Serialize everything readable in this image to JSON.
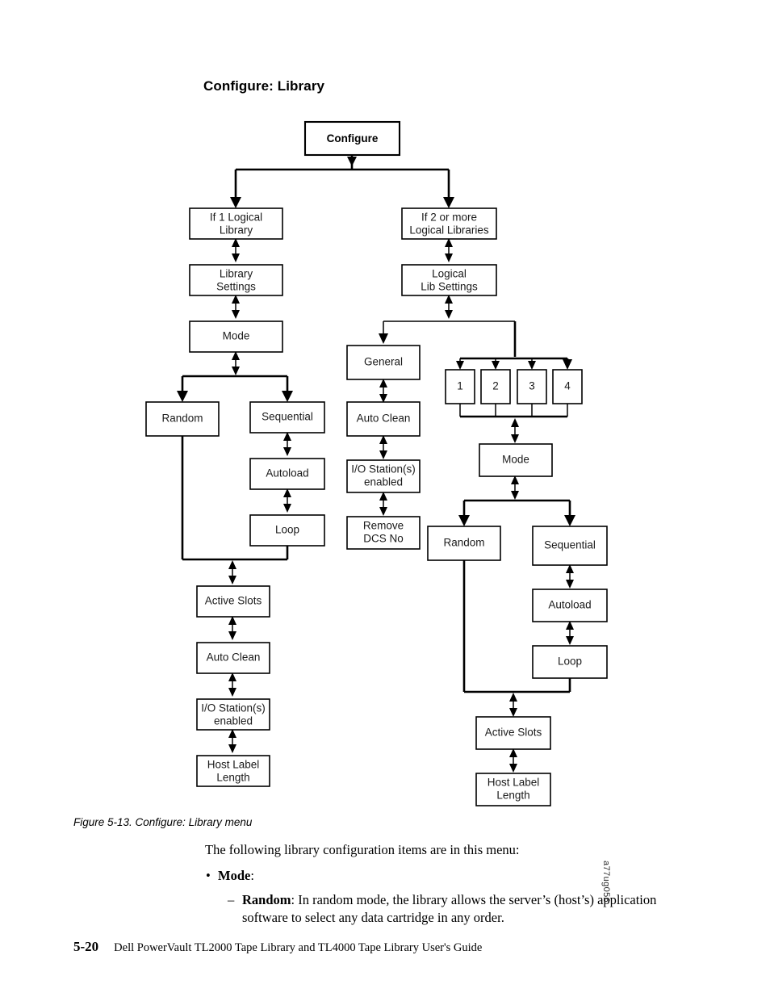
{
  "section": {
    "title": "Configure: Library"
  },
  "figure": {
    "caption": "Figure 5-13. Configure: Library menu",
    "figure_id": "a77ug056",
    "nodes": {
      "configure": "Configure",
      "if_one_logical_library": "If 1 Logical\nLibrary",
      "if_two_or_more": "If 2 or more\nLogical Libraries",
      "library_settings": "Library\nSettings",
      "logical_lib_settings": "Logical\nLib Settings",
      "mode_left": "Mode",
      "random_left": "Random",
      "sequential_left": "Sequential",
      "autoload_left": "Autoload",
      "loop_left": "Loop",
      "active_slots_left": "Active Slots",
      "auto_clean_left": "Auto Clean",
      "io_station_left": "I/O Station(s)\nenabled",
      "host_label_length_left": "Host Label\nLength",
      "general": "General",
      "auto_clean_mid": "Auto Clean",
      "io_station_mid": "I/O Station(s)\nenabled",
      "remove_dcs_no": "Remove\nDCS No",
      "lib_1": "1",
      "lib_2": "2",
      "lib_3": "3",
      "lib_4": "4",
      "mode_right": "Mode",
      "random_right": "Random",
      "sequential_right": "Sequential",
      "autoload_right": "Autoload",
      "loop_right": "Loop",
      "active_slots_right": "Active Slots",
      "host_label_length_right": "Host Label\nLength"
    }
  },
  "body": {
    "intro": "The following library configuration items are in this menu:",
    "bullet_marker_level1": "•",
    "bullet_marker_level2": "–",
    "mode_item_label": "Mode",
    "mode_item_colon": ":",
    "random_item_label": "Random",
    "random_item_text": ": In random mode, the library allows the server’s (host’s) application",
    "random_item_text_cont": "software to select any data cartridge in any order."
  },
  "footer": {
    "page_number": "5-20",
    "doc_title": "Dell PowerVault TL2000 Tape Library and TL4000 Tape Library User's Guide"
  }
}
